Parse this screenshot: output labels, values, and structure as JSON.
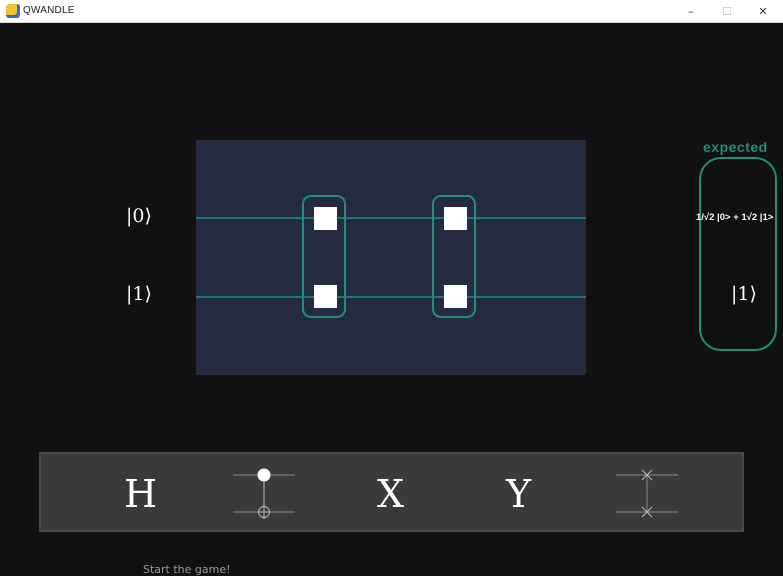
{
  "window": {
    "title": "QWANDLE",
    "minimize_glyph": "–",
    "maximize_glyph": "☐",
    "close_glyph": "✕"
  },
  "circuit": {
    "input_states": [
      "|0⟩",
      "|1⟩"
    ],
    "gates": [
      "cnot",
      "cnot"
    ]
  },
  "expected": {
    "label": "expected",
    "states": [
      "1/√2 |0> + 1√2 |1>",
      "|1⟩"
    ]
  },
  "palette": {
    "gates": [
      {
        "name": "hadamard",
        "label": "H"
      },
      {
        "name": "cnot",
        "label": ""
      },
      {
        "name": "pauli-x",
        "label": "X"
      },
      {
        "name": "pauli-y",
        "label": "Y"
      },
      {
        "name": "swap",
        "label": ""
      }
    ]
  },
  "footer": {
    "message": "Start the game!"
  },
  "colors": {
    "background": "#111111",
    "board": "#242b3e",
    "accent": "#1f8f76",
    "palette": "#3a3a3a"
  }
}
